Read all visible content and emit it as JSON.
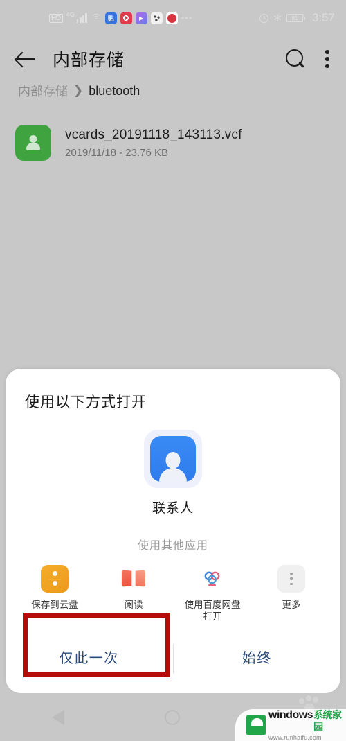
{
  "status_bar": {
    "hd_label": "HD",
    "network_label": "4G",
    "icons": [
      "hd-badge",
      "4g-label",
      "signal-bars-icon",
      "wifi-icon",
      "tieba-app-icon",
      "video-app-icon",
      "player-app-icon",
      "game-app-icon",
      "pdd-app-icon",
      "more-dots-icon"
    ],
    "alarm_icon": "alarm-icon",
    "bluetooth_icon": "bluetooth-icon",
    "battery_level": "81",
    "time": "3:57"
  },
  "app_bar": {
    "back_icon": "back-arrow-icon",
    "title": "内部存储",
    "search_icon": "search-icon",
    "overflow_icon": "overflow-menu-icon"
  },
  "breadcrumb": {
    "root": "内部存储",
    "separator": "❯",
    "current": "bluetooth"
  },
  "file_list": {
    "items": [
      {
        "icon": "contact-file-icon",
        "name": "vcards_20191118_143113.vcf",
        "meta": "2019/11/18 - 23.76 KB"
      }
    ]
  },
  "sheet": {
    "title": "使用以下方式打开",
    "primary_app": {
      "icon": "contacts-app-icon",
      "label": "联系人"
    },
    "other_apps_title": "使用其他应用",
    "other_apps": [
      {
        "icon": "cloud-save-icon",
        "label": "保存到云盘"
      },
      {
        "icon": "book-reader-icon",
        "label": "阅读"
      },
      {
        "icon": "baidu-netdisk-icon",
        "label": "使用百度网盘打开"
      },
      {
        "icon": "more-apps-icon",
        "label": "更多"
      }
    ],
    "actions": {
      "once_label": "仅此一次",
      "always_label": "始终"
    }
  },
  "annotation": {
    "target": "仅此一次",
    "color": "#b50b0b"
  },
  "nav_bar": {
    "back_icon": "nav-back-icon",
    "home_icon": "nav-home-icon",
    "recent_icon": "nav-recent-icon"
  },
  "watermark": {
    "brand_en": "windows",
    "brand_cn": "系统家园",
    "url": "www.runhaifu.com"
  },
  "colors": {
    "page_background": "#c8c8c8",
    "sheet_background": "#ffffff",
    "file_icon": "#3fa340",
    "contacts_icon": "#3a8bf5",
    "action_text": "#2a4a7c",
    "annotation": "#b50b0b"
  }
}
